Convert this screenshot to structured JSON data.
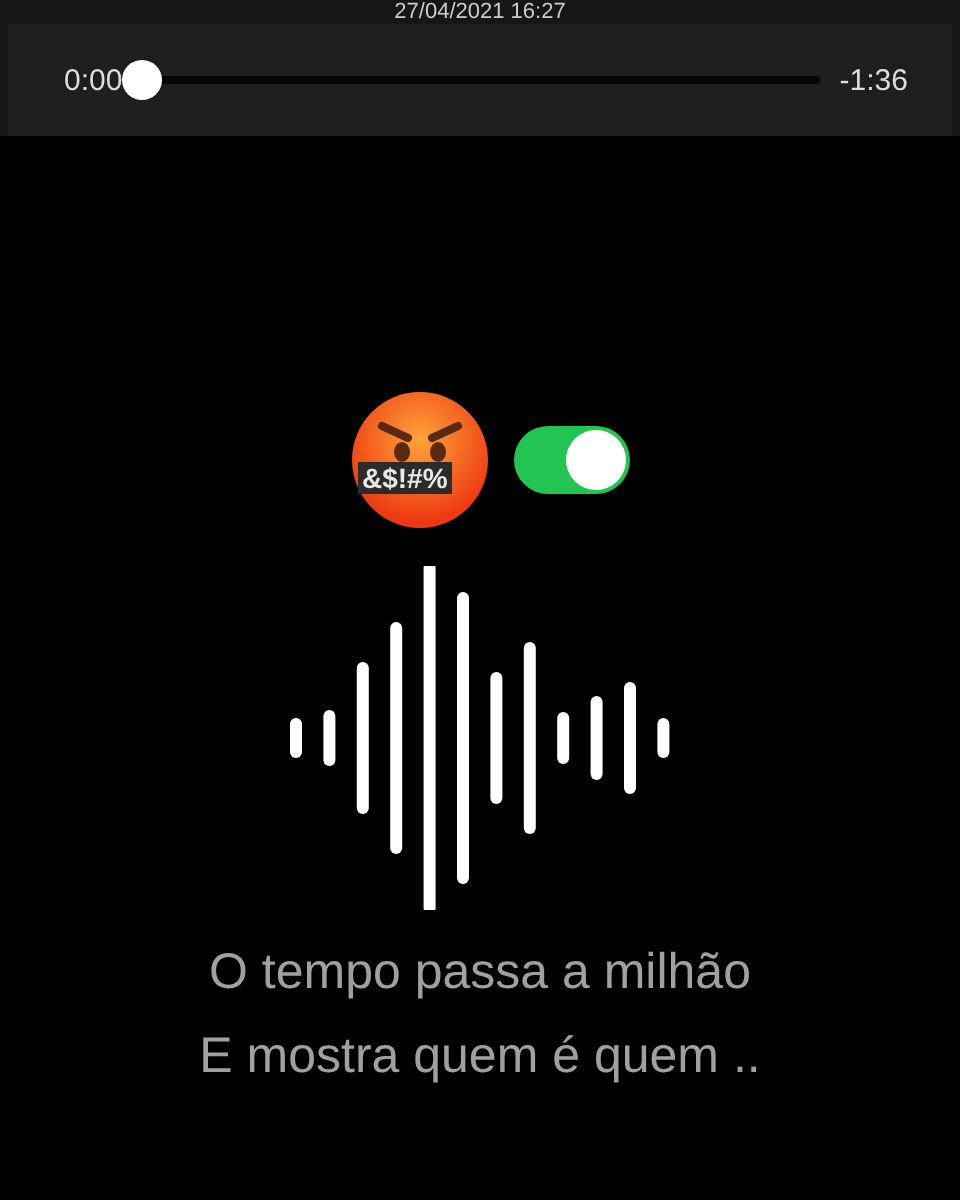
{
  "header": {
    "date": "27/04/2021 16:27"
  },
  "player": {
    "elapsed": "0:00",
    "remaining": "-1:36",
    "level": 0
  },
  "emoji": {
    "symbols": "&$!#%"
  },
  "toggle": {
    "on": true
  },
  "caption": [
    "O tempo passa a milhão",
    "E mostra quem é quem .."
  ]
}
